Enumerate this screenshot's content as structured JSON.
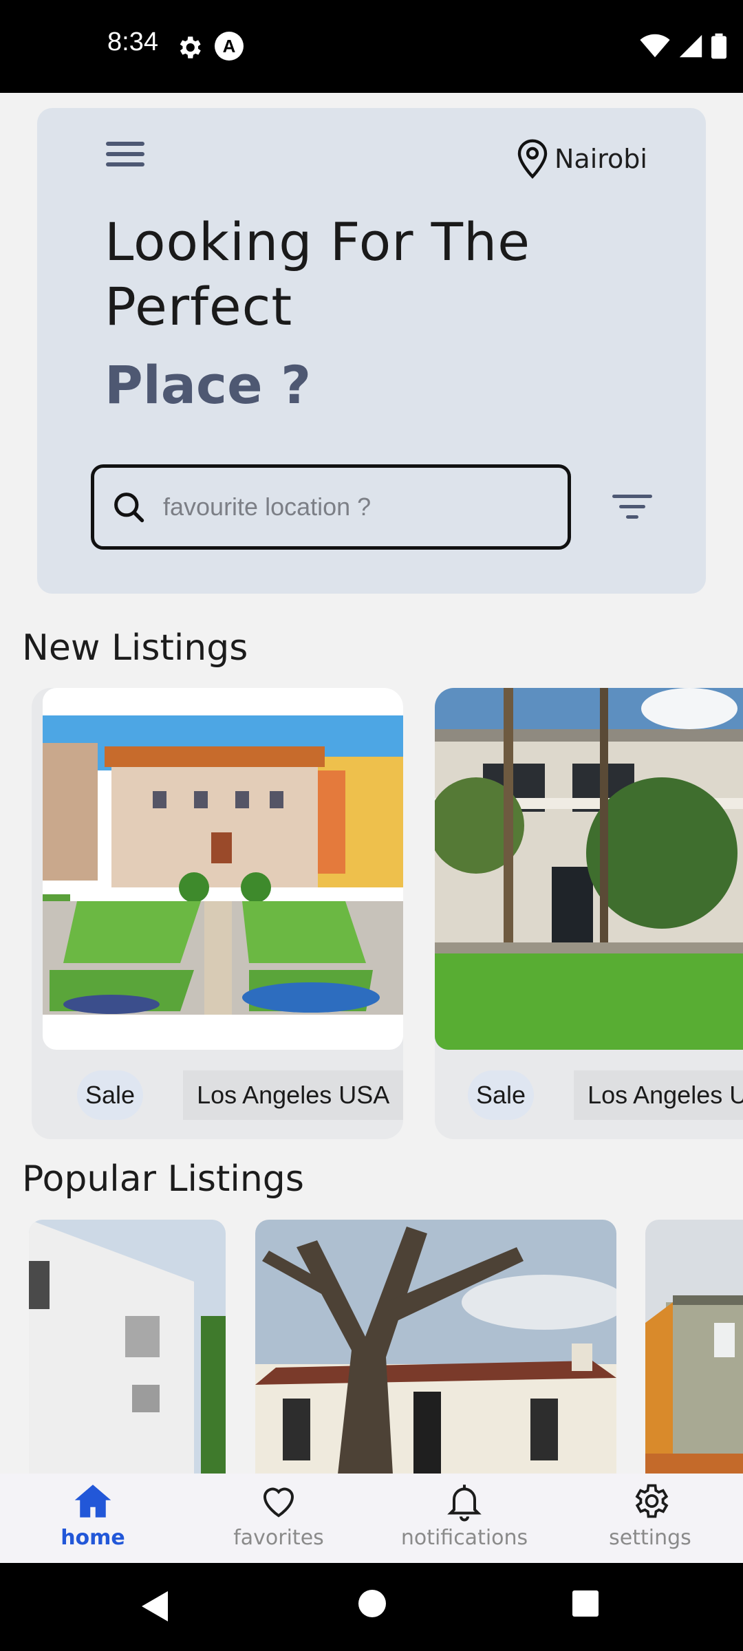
{
  "status_bar": {
    "time": "8:34",
    "a_glyph": "A"
  },
  "header": {
    "location": "Nairobi"
  },
  "hero": {
    "title": "Looking For The Perfect",
    "place": "Place ?",
    "search_placeholder": "favourite location ?"
  },
  "new_listings": {
    "title": "New Listings",
    "items": [
      {
        "tag": "Sale",
        "location": "Los Angeles USA"
      },
      {
        "tag": "Sale",
        "location": "Los Angeles USA"
      }
    ]
  },
  "popular_listings": {
    "title": "Popular Listings"
  },
  "bottom_nav": {
    "items": [
      {
        "label": "home",
        "icon": "home-icon",
        "active": true
      },
      {
        "label": "favorites",
        "icon": "heart-icon",
        "active": false
      },
      {
        "label": "notifications",
        "icon": "bell-icon",
        "active": false
      },
      {
        "label": "settings",
        "icon": "gear-icon",
        "active": false
      }
    ]
  },
  "colors": {
    "accent": "#2257d8",
    "hero_bg": "#dde3eb",
    "place_text": "#4e5872"
  }
}
